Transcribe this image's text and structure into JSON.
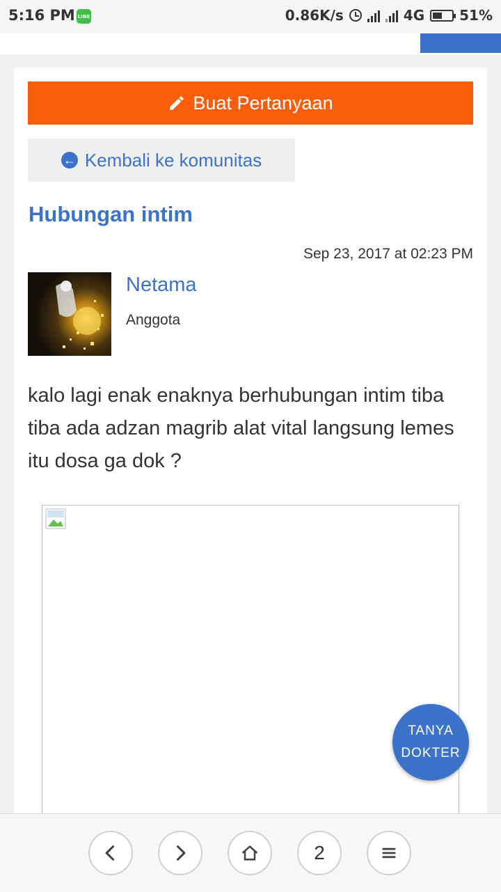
{
  "status_bar": {
    "time": "5:16 PM",
    "chat_app_icon": "LINE",
    "net_speed": "0.86K/s",
    "network": "4G",
    "battery": "51%",
    "battery_level": 0.51
  },
  "toolbar": {
    "ask_label": "Buat Pertanyaan",
    "ask_icon": "pencil-icon",
    "back_label": "Kembali ke komunitas",
    "back_icon": "arrow-left-circle-icon"
  },
  "post": {
    "title": "Hubungan intim",
    "date": "Sep 23, 2017 at 02:23 PM",
    "author": "Netama",
    "role": "Anggota",
    "body": "kalo lagi enak enaknya berhubungan intim tiba tiba ada adzan magrib alat vital langsung lemes itu dosa ga dok ?"
  },
  "fab": {
    "line1": "TANYA",
    "line2": "DOKTER"
  },
  "browser_nav": {
    "tab_count": "2",
    "icons": [
      "chevron-left-icon",
      "chevron-right-icon",
      "home-icon",
      "tabs-icon",
      "menu-icon"
    ]
  },
  "colors": {
    "brand_orange": "#fa5e0b",
    "brand_blue": "#3a73c9"
  }
}
